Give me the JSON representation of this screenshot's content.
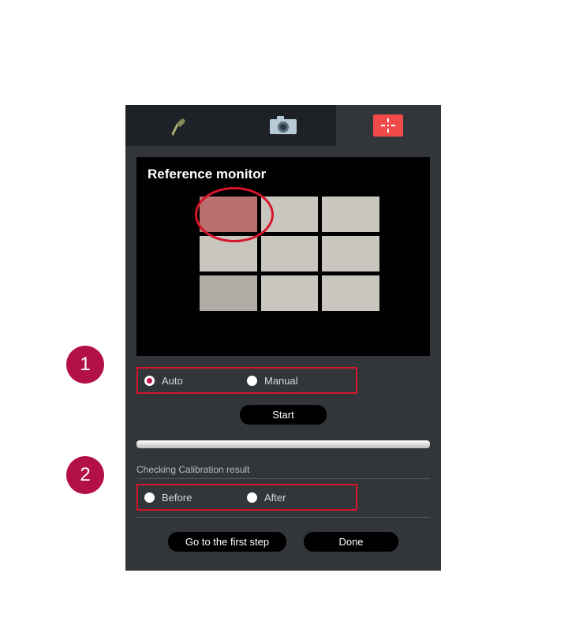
{
  "preview": {
    "title": "Reference monitor"
  },
  "mode": {
    "options": {
      "auto": "Auto",
      "manual": "Manual"
    },
    "selected": "auto"
  },
  "buttons": {
    "start": "Start",
    "first_step": "Go to the first step",
    "done": "Done"
  },
  "result": {
    "section_label": "Checking Calibration result",
    "options": {
      "before": "Before",
      "after": "After"
    }
  },
  "callouts": {
    "one": "1",
    "two": "2"
  }
}
